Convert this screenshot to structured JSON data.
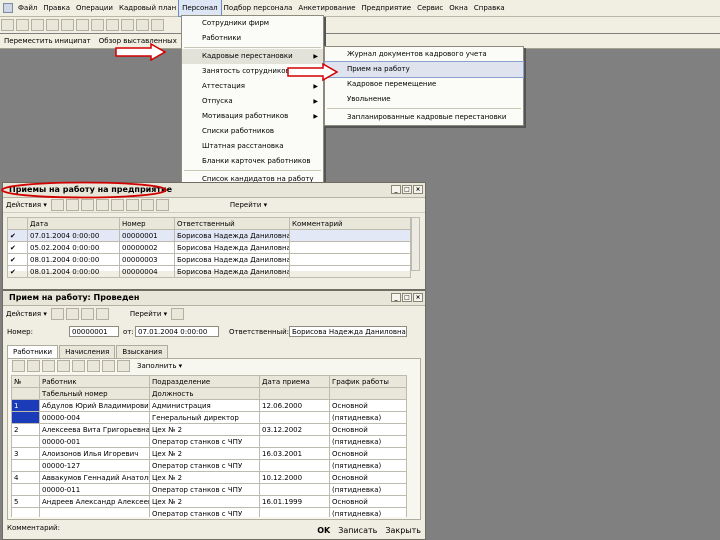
{
  "menubar": {
    "items": [
      "Файл",
      "Правка",
      "Операции",
      "Кадровый план",
      "Персонал",
      "Подбор персонала",
      "Анкетирование",
      "Предприятие",
      "Сервис",
      "Окна",
      "Справка"
    ]
  },
  "toolbar2": {
    "label1": "Переместить иниципат",
    "label2": "Обзор выставленных"
  },
  "menu_personal": {
    "items": [
      {
        "label": "Сотрудники фирм",
        "arrow": ""
      },
      {
        "label": "Работники",
        "arrow": ""
      },
      {
        "label": "Кадровые перестановки",
        "arrow": "▶"
      },
      {
        "label": "Занятость сотрудников",
        "arrow": "▶"
      },
      {
        "label": "Аттестация",
        "arrow": "▶"
      },
      {
        "label": "Отпуска",
        "arrow": "▶"
      },
      {
        "label": "Мотивация работников",
        "arrow": "▶"
      },
      {
        "label": "Списки работников",
        "arrow": ""
      },
      {
        "label": "Штатная расстановка",
        "arrow": ""
      },
      {
        "label": "Бланки карточек работников",
        "arrow": ""
      },
      {
        "label": "Список кандидатов на работу",
        "arrow": ""
      }
    ]
  },
  "menu_kadr": {
    "items": [
      "Журнал документов кадрового учета",
      "Прием на работу",
      "Кадровое перемещение",
      "Увольнение",
      "Запланированные кадровые перестановки"
    ]
  },
  "journal": {
    "title": "Приемы на работу на предприятие",
    "actions": "Действия ▾",
    "goto": "Перейти ▾",
    "headers": [
      "Дата",
      "Номер",
      "Ответственный",
      "Комментарий"
    ],
    "rows": [
      [
        "07.01.2004 0:00:00",
        "00000001",
        "Борисова Надежда Даниловна",
        ""
      ],
      [
        "05.02.2004 0:00:00",
        "00000002",
        "Борисова Надежда Даниловна",
        ""
      ],
      [
        "08.01.2004 0:00:00",
        "00000003",
        "Борисова Надежда Даниловна",
        ""
      ],
      [
        "08.01.2004 0:00:00",
        "00000004",
        "Борисова Надежда Даниловна",
        ""
      ]
    ]
  },
  "doc": {
    "title": "Прием на работу: Проведен",
    "actions": "Действия ▾",
    "goto": "Перейти ▾",
    "number_label": "Номер:",
    "number_value": "00000001",
    "date_label": "от:",
    "date_value": "07.01.2004 0:00:00",
    "resp_label": "Ответственный:",
    "resp_value": "Борисова Надежда Даниловна",
    "tabs": [
      "Работники",
      "Начисления",
      "Взыскания"
    ],
    "fill_button": "Заполнить ▾",
    "headers": [
      "№",
      "Работник",
      "Подразделение",
      "Дата приема",
      "График работы"
    ],
    "subheaders": [
      "",
      "Табельный номер",
      "Должность",
      "",
      ""
    ],
    "rows": [
      [
        "1",
        "Абдулов Юрий Владимирович",
        "Администрация",
        "12.06.2000",
        "Основной"
      ],
      [
        "",
        "00000-004",
        "Генеральный директор",
        "",
        "(пятидневка)"
      ],
      [
        "2",
        "Алексеева Вита Григорьевна",
        "Цех № 2",
        "03.12.2002",
        "Основной"
      ],
      [
        "",
        "00000-001",
        "Оператор станков с ЧПУ",
        "",
        "(пятидневка)"
      ],
      [
        "3",
        "Алоизонов Илья Игоревич",
        "Цех № 2",
        "16.03.2001",
        "Основной"
      ],
      [
        "",
        "00000-127",
        "Оператор станков с ЧПУ",
        "",
        "(пятидневка)"
      ],
      [
        "4",
        "Аввакумов Геннадий Анатольевич",
        "Цех № 2",
        "10.12.2000",
        "Основной"
      ],
      [
        "",
        "00000-011",
        "Оператор станков с ЧПУ",
        "",
        "(пятидневка)"
      ],
      [
        "5",
        "Андреев Александр Алексеевич",
        "Цех № 2",
        "16.01.1999",
        "Основной"
      ],
      [
        "",
        "",
        "Оператор станков с ЧПУ",
        "",
        "(пятидневка)"
      ]
    ],
    "comment_label": "Комментарий:",
    "ok": "OK",
    "write": "Записать",
    "close": "Закрыть"
  },
  "colors": {
    "accent_red": "#d10000",
    "selection_blue": "#1c3bb8"
  }
}
